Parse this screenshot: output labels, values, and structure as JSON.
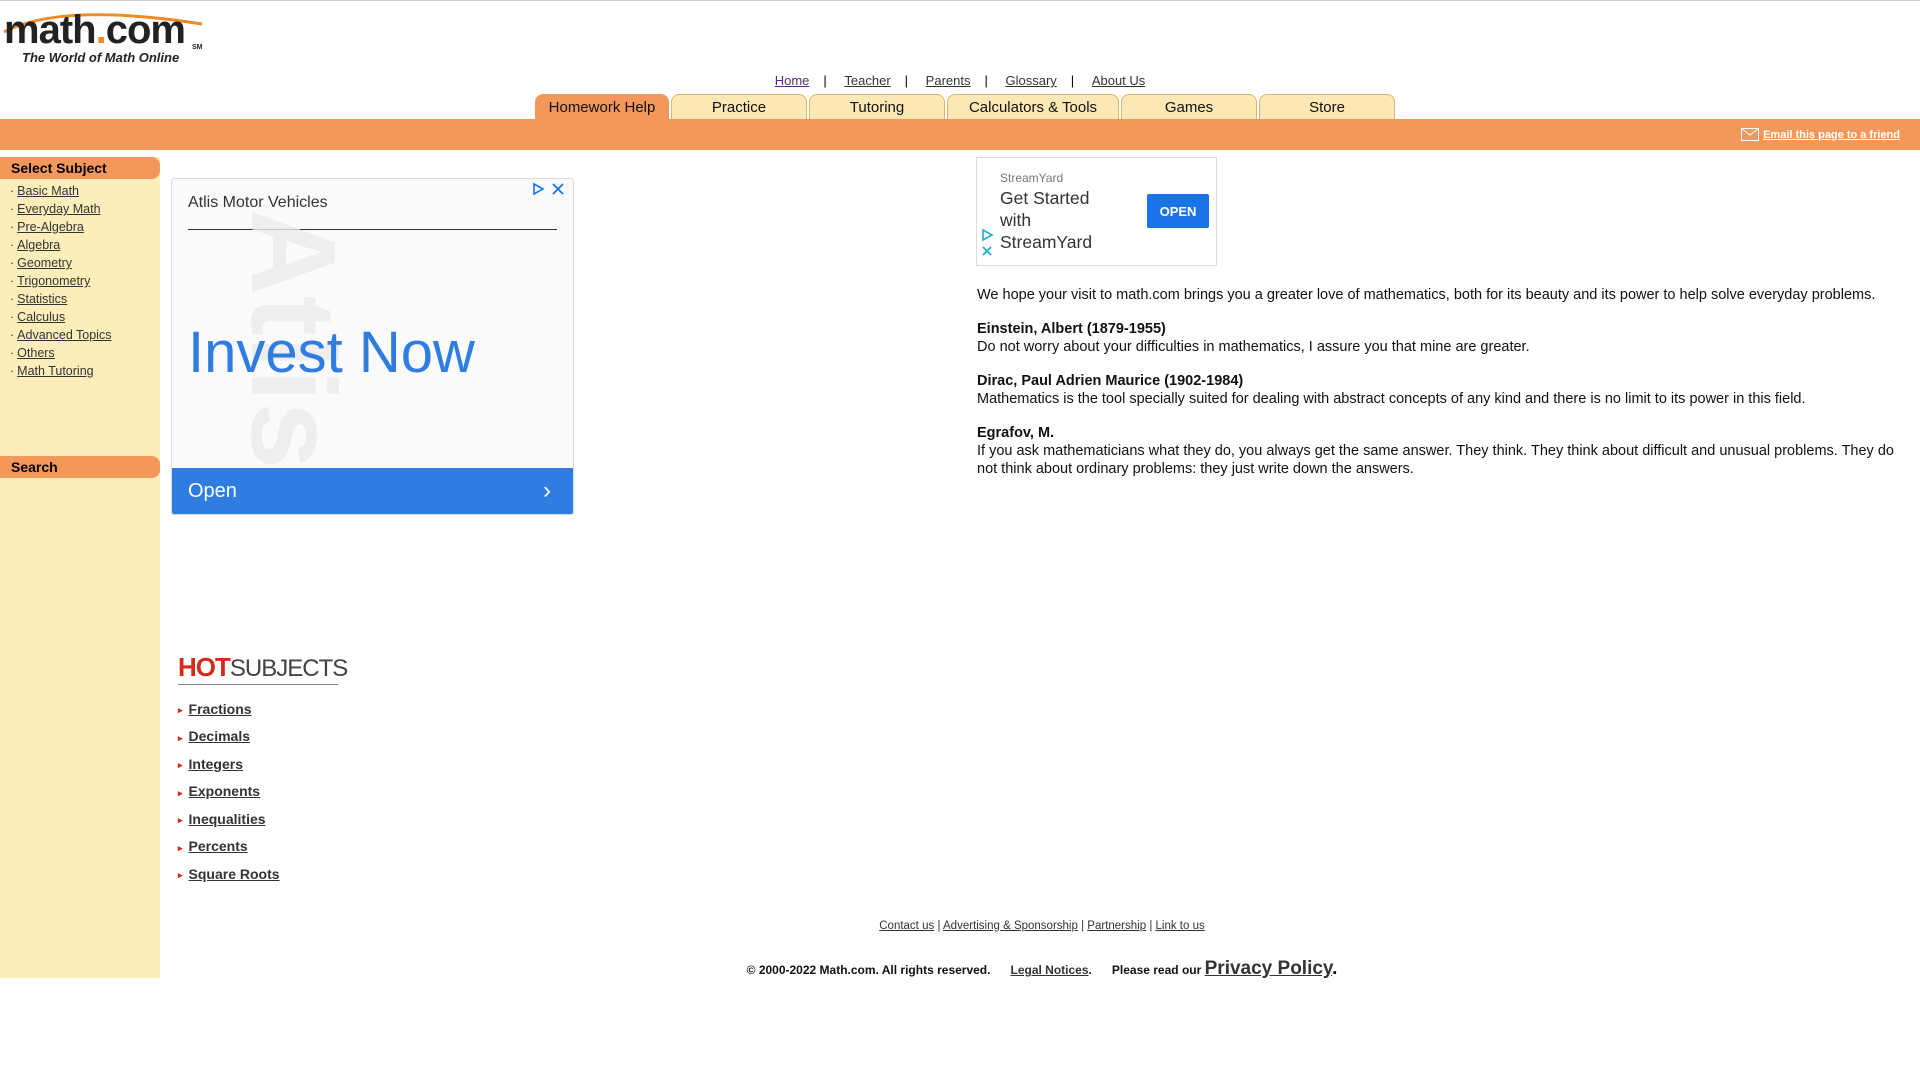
{
  "logo": {
    "word_a": "math",
    "dot": ".",
    "word_b": "com",
    "sm": "SM",
    "tagline": "The World of Math Online"
  },
  "topnav": {
    "links": [
      "Home",
      "Teacher",
      "Parents",
      "Glossary",
      "About Us"
    ],
    "separator": "|"
  },
  "tabs": [
    {
      "label": "Homework Help",
      "active": true
    },
    {
      "label": "Practice"
    },
    {
      "label": "Tutoring"
    },
    {
      "label": "Calculators & Tools"
    },
    {
      "label": "Games"
    },
    {
      "label": "Store"
    }
  ],
  "email_link": "Email this page to a friend",
  "sidebar": {
    "subject_header": "Select Subject",
    "bullet": "·",
    "subjects": [
      "Basic Math",
      "Everyday Math",
      "Pre-Algebra",
      "Algebra",
      "Geometry",
      "Trigonometry",
      "Statistics",
      "Calculus",
      "Advanced Topics",
      "Others",
      "Math Tutoring"
    ],
    "search_header": "Search"
  },
  "ad1": {
    "brand": "Atlis Motor Vehicles",
    "watermark": "Atlis",
    "headline": "Invest Now",
    "cta": "Open",
    "chevron": "›"
  },
  "ad2": {
    "brand": "StreamYard",
    "title": "Get Started with StreamYard",
    "open": "OPEN"
  },
  "main": {
    "intro": "We hope your visit to math.com brings you a greater love of mathematics, both for its beauty and its power to help solve everyday problems.",
    "quotes": [
      {
        "author": "Einstein, Albert (1879-1955)",
        "text": "Do not worry about your difficulties in mathematics, I assure you that mine are greater."
      },
      {
        "author": "Dirac, Paul Adrien Maurice (1902-1984)",
        "text": "Mathematics is the tool specially suited for dealing with abstract concepts of any kind and there is no limit to its power in this field."
      },
      {
        "author": "Egrafov, M.",
        "text": "If you ask mathematicians what they do, you always get the same answer. They think. They think about difficult and unusual problems. They do not think about ordinary problems: they just write down the answers."
      }
    ]
  },
  "hot_subjects": {
    "title_hot": "HOT",
    "title_subjects": "SUBJECTS",
    "arrow": "▸",
    "items": [
      "Fractions",
      "Decimals",
      "Integers",
      "Exponents",
      "Inequalities",
      "Percents",
      "Square Roots"
    ]
  },
  "footer": {
    "links": [
      "Contact us",
      "Advertising & Sponsorship",
      "Partnership",
      "Link to us"
    ],
    "separator": "|",
    "copyright": "© 2000-2022 Math.com. All rights reserved.",
    "legal": "Legal Notices",
    "period": ".",
    "please": "Please read our",
    "privacy": "Privacy Policy",
    "privacy_period": "."
  },
  "colors": {
    "orange": "#f4975b",
    "tab_bg": "#fbe8b4",
    "sidebar_bg": "#fbeebb",
    "ad_blue": "#2f7de1",
    "hot_red": "#d62a19"
  }
}
